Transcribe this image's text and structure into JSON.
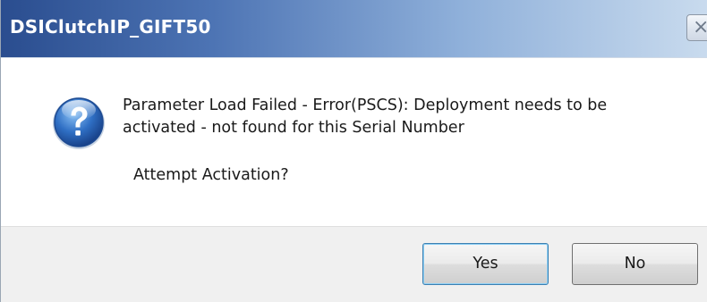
{
  "window": {
    "title": "DSIClutchIP_GIFT50",
    "close_glyph": "×"
  },
  "dialog": {
    "icon": "question-icon",
    "message": "Parameter Load Failed - Error(PSCS): Deployment needs to be activated - not found for this Serial Number",
    "prompt": "Attempt Activation?"
  },
  "buttons": {
    "yes_label": "Yes",
    "no_label": "No"
  },
  "colors": {
    "titlebar_start": "#2a4d8f",
    "titlebar_end": "#c9dbee",
    "footer_bg": "#f0f0f0",
    "icon_blue": "#2f6fc4"
  }
}
